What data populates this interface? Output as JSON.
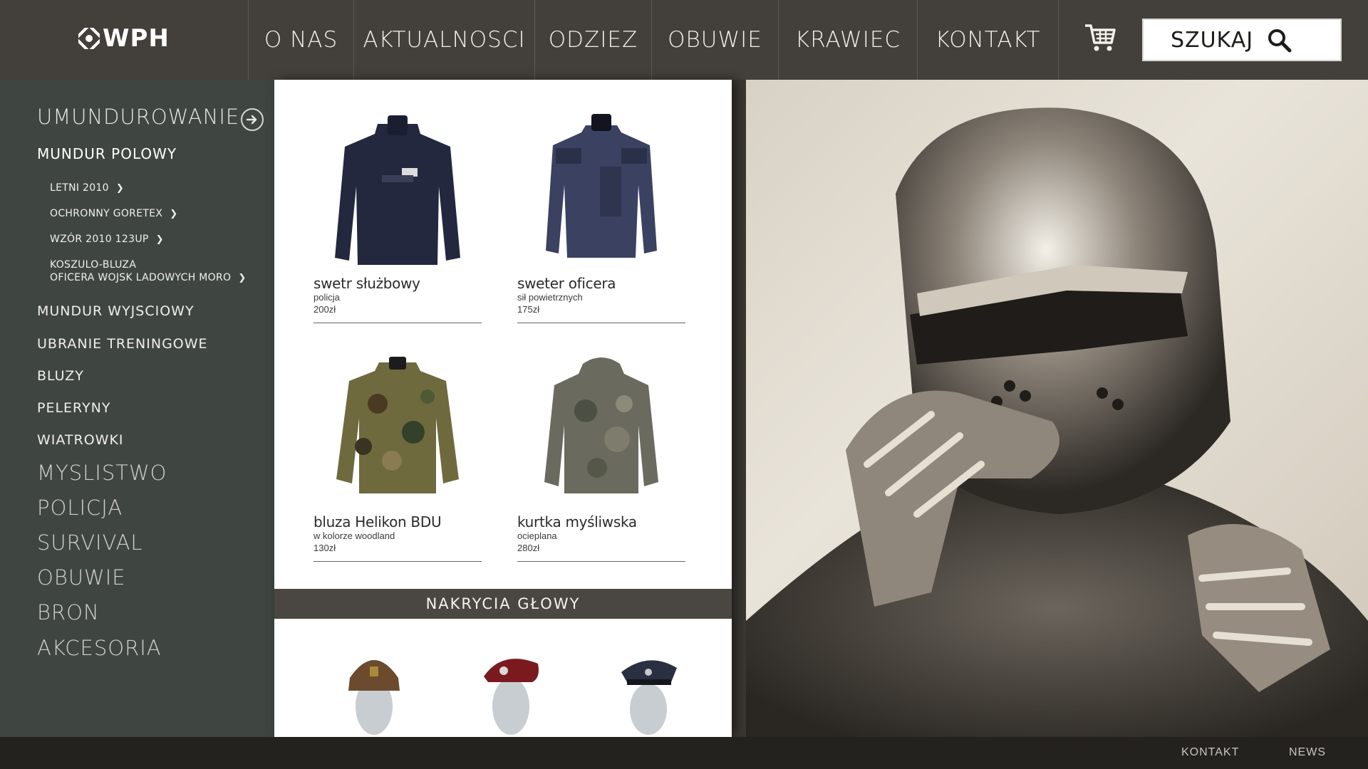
{
  "header": {
    "logo_text": "WPH",
    "nav": [
      "O NAS",
      "AKTUALNOSCI",
      "ODZIEZ",
      "OBUWIE",
      "KRAWIEC",
      "KONTAKT"
    ],
    "search_label": "SZUKAJ"
  },
  "sidebar": {
    "active_category": "UMUNDUROWANIE",
    "selected_sub": "MUNDUR POLOWY",
    "subsub": [
      "LETNI 2010",
      "OCHRONNY GORETEX",
      "WZÓR 2010 123UP",
      "KOSZULO-BLUZA",
      "OFICERA WOJSK LADOWYCH MORO"
    ],
    "subs": [
      "MUNDUR WYJSCIOWY",
      "UBRANIE TRENINGOWE",
      "BLUZY",
      "PELERYNY",
      "WIATROWKI"
    ],
    "categories": [
      "MYSLISTWO",
      "POLICJA",
      "SURVIVAL",
      "OBUWIE",
      "BRON",
      "AKCESORIA"
    ]
  },
  "products": [
    {
      "name": "swetr służbowy",
      "sub": "policja",
      "price": "200zł"
    },
    {
      "name": "sweter oficera",
      "sub": "sił powietrznych",
      "price": "175zł"
    },
    {
      "name": "bluza Helikon BDU",
      "sub": "w kolorze woodland",
      "price": "130zł"
    },
    {
      "name": "kurtka myśliwska",
      "sub": "ocieplana",
      "price": "280zł"
    }
  ],
  "section_title": "NAKRYCIA GŁOWY",
  "footer": {
    "links": [
      "KONTAKT",
      "NEWS"
    ]
  },
  "colors": {
    "header": "#433f3a",
    "sidebar": "#3f4642",
    "footer": "#24221f",
    "panel": "#ffffff"
  }
}
